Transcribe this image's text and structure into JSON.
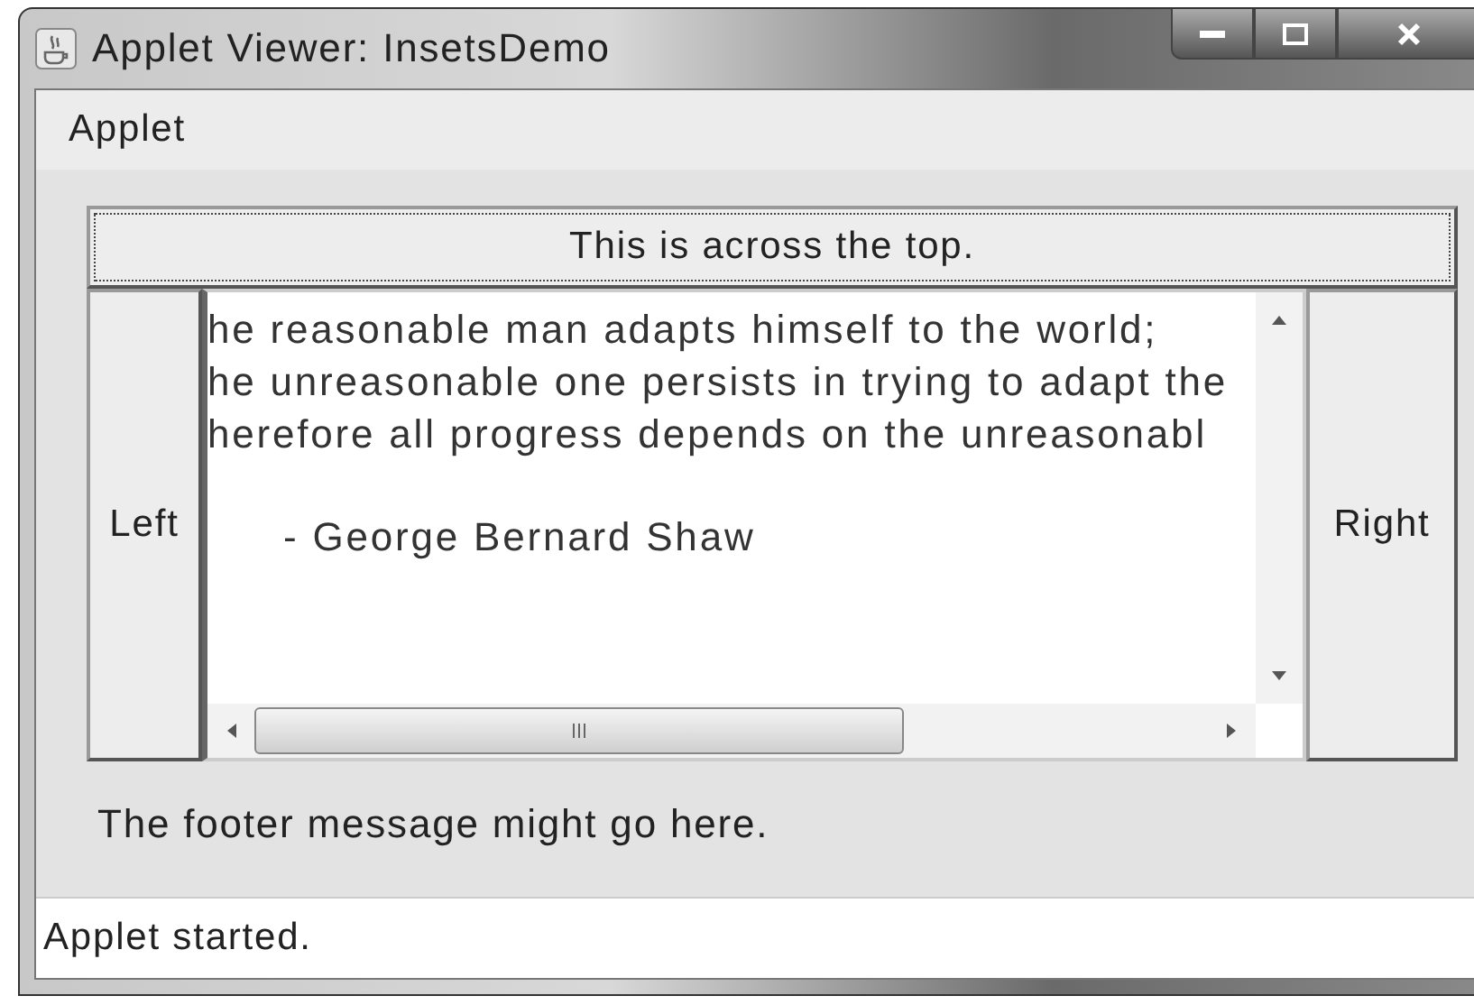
{
  "window": {
    "title": "Applet Viewer: InsetsDemo"
  },
  "menu_bar": {
    "items": [
      "Applet"
    ]
  },
  "applet": {
    "top_button": "This is across the top.",
    "left_button": "Left",
    "right_button": "Right",
    "text_area": {
      "lines": [
        "he reasonable man adapts himself to the world;",
        "he unreasonable one persists in trying to adapt the",
        "herefore all progress depends on the unreasonabl"
      ],
      "attribution": "- George Bernard Shaw"
    },
    "footer": "The footer message might go here."
  },
  "status_bar": "Applet started."
}
